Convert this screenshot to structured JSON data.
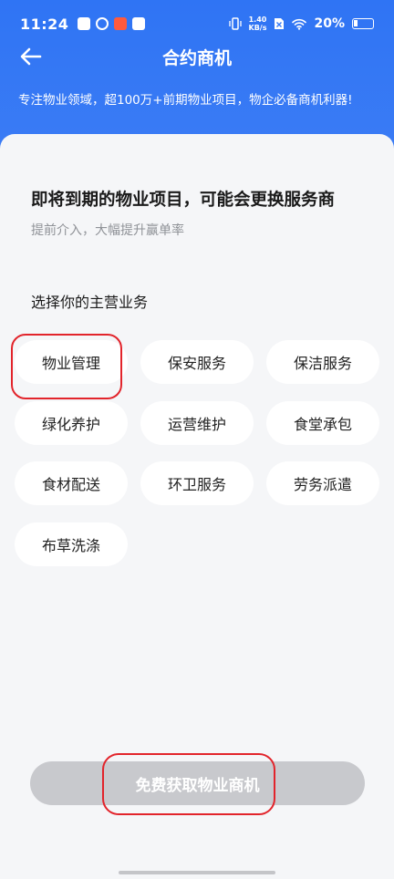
{
  "status_bar": {
    "time": "11:24",
    "net_speed_value": "1.40",
    "net_speed_unit": "KB/s",
    "battery": "20%"
  },
  "header": {
    "title": "合约商机",
    "subtitle": "专注物业领域，超100万+前期物业项目，物企必备商机利器!"
  },
  "main": {
    "headline": "即将到期的物业项目，可能会更换服务商",
    "hint": "提前介入，大幅提升赢单率",
    "section_label": "选择你的主营业务",
    "options": [
      {
        "label": "物业管理"
      },
      {
        "label": "保安服务"
      },
      {
        "label": "保洁服务"
      },
      {
        "label": "绿化养护"
      },
      {
        "label": "运营维护"
      },
      {
        "label": "食堂承包"
      },
      {
        "label": "食材配送"
      },
      {
        "label": "环卫服务"
      },
      {
        "label": "劳务派遣"
      },
      {
        "label": "布草洗涤"
      }
    ]
  },
  "cta": {
    "label": "免费获取物业商机"
  },
  "colors": {
    "header_blue": "#3478f6",
    "chip_bg": "#ffffff",
    "cta_disabled": "#c8c9cd",
    "annotation_red": "#e2242b"
  }
}
